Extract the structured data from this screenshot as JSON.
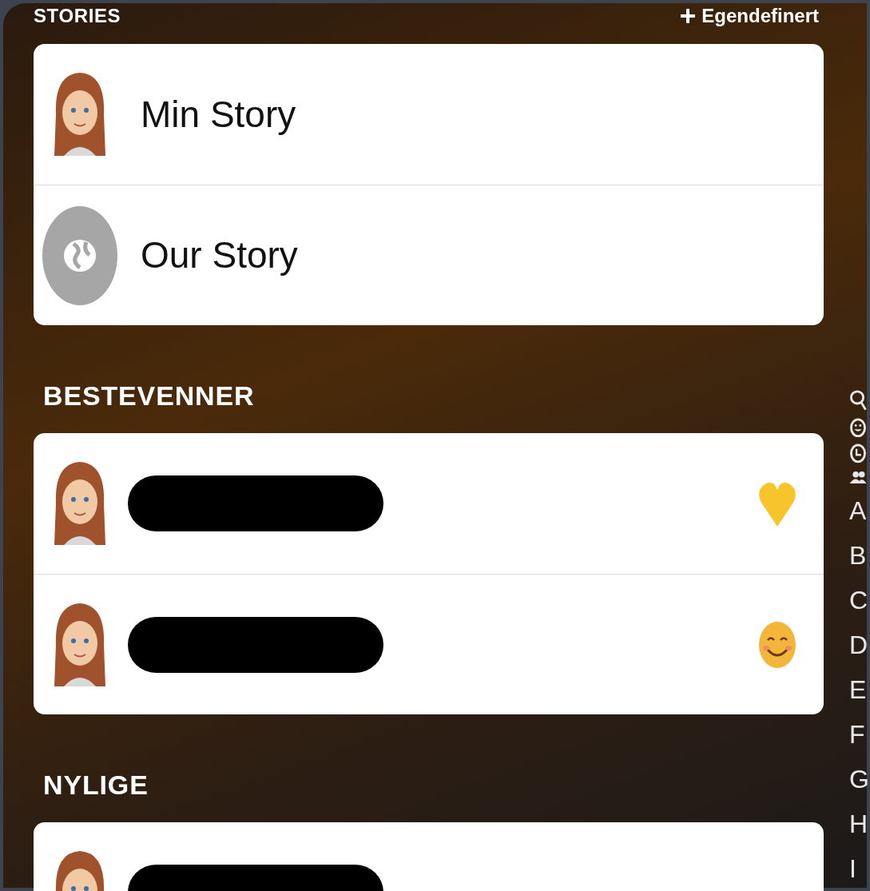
{
  "header": {
    "title": "STORIES",
    "action": "Egendefinert"
  },
  "stories": [
    {
      "name": "Min Story",
      "kind": "bitmoji"
    },
    {
      "name": "Our Story",
      "kind": "globe"
    }
  ],
  "sections": [
    {
      "title": "BESTEVENNER",
      "friends": [
        {
          "kind": "heart"
        },
        {
          "kind": "smile"
        }
      ]
    },
    {
      "title": "NYLIGE",
      "friends": [
        {
          "kind": "plain"
        }
      ]
    }
  ],
  "index": [
    {
      "kind": "search"
    },
    {
      "kind": "smiley"
    },
    {
      "kind": "clock"
    },
    {
      "kind": "group"
    },
    {
      "kind": "letter",
      "label": "A"
    },
    {
      "kind": "letter",
      "label": "B"
    },
    {
      "kind": "letter",
      "label": "C"
    },
    {
      "kind": "letter",
      "label": "D"
    },
    {
      "kind": "letter",
      "label": "E"
    },
    {
      "kind": "letter",
      "label": "F"
    },
    {
      "kind": "letter",
      "label": "G"
    },
    {
      "kind": "letter",
      "label": "H"
    },
    {
      "kind": "letter",
      "label": "I"
    }
  ]
}
